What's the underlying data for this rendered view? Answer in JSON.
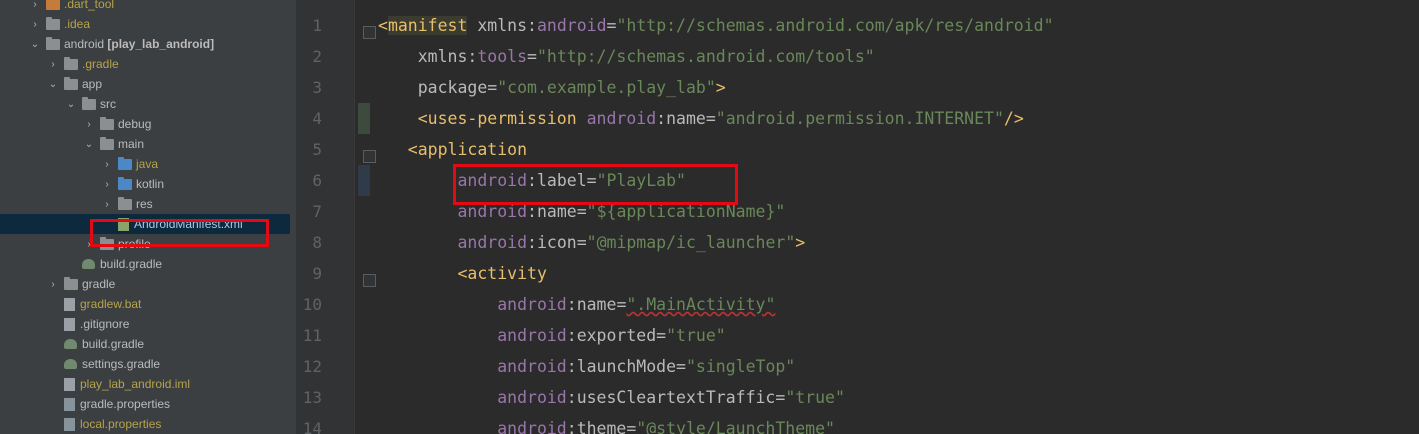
{
  "tree": {
    "items": [
      {
        "label": ".dart_tool",
        "indent": 1,
        "arrow": "right",
        "icon": "folder-orange",
        "style": "yellow"
      },
      {
        "label": ".idea",
        "indent": 1,
        "arrow": "right",
        "icon": "folder-gray",
        "style": "yellow"
      },
      {
        "label": "android [play_lab_android]",
        "indent": 1,
        "arrow": "down",
        "icon": "folder-gray",
        "style": "bold"
      },
      {
        "label": ".gradle",
        "indent": 2,
        "arrow": "right",
        "icon": "folder-gray",
        "style": "yellow"
      },
      {
        "label": "app",
        "indent": 2,
        "arrow": "down",
        "icon": "folder-gray",
        "style": "normal"
      },
      {
        "label": "src",
        "indent": 3,
        "arrow": "down",
        "icon": "folder-gray",
        "style": "normal"
      },
      {
        "label": "debug",
        "indent": 4,
        "arrow": "right",
        "icon": "folder-gray",
        "style": "normal"
      },
      {
        "label": "main",
        "indent": 4,
        "arrow": "down",
        "icon": "folder-gray",
        "style": "normal"
      },
      {
        "label": "java",
        "indent": 5,
        "arrow": "right",
        "icon": "folder-blue",
        "style": "yellow"
      },
      {
        "label": "kotlin",
        "indent": 5,
        "arrow": "right",
        "icon": "folder-blue",
        "style": "normal"
      },
      {
        "label": "res",
        "indent": 5,
        "arrow": "right",
        "icon": "folder-gray",
        "style": "normal"
      },
      {
        "label": "AndroidManifest.xml",
        "indent": 5,
        "arrow": "none",
        "icon": "file-xml",
        "style": "selected"
      },
      {
        "label": "profile",
        "indent": 4,
        "arrow": "right",
        "icon": "folder-gray",
        "style": "normal"
      },
      {
        "label": "build.gradle",
        "indent": 3,
        "arrow": "none",
        "icon": "file-gradle",
        "style": "normal"
      },
      {
        "label": "gradle",
        "indent": 2,
        "arrow": "right",
        "icon": "folder-gray",
        "style": "normal"
      },
      {
        "label": "gradlew.bat",
        "indent": 2,
        "arrow": "none",
        "icon": "file-doc",
        "style": "yellow"
      },
      {
        "label": ".gitignore",
        "indent": 2,
        "arrow": "none",
        "icon": "file-doc",
        "style": "normal"
      },
      {
        "label": "build.gradle",
        "indent": 2,
        "arrow": "none",
        "icon": "file-gradle",
        "style": "normal"
      },
      {
        "label": "settings.gradle",
        "indent": 2,
        "arrow": "none",
        "icon": "file-gradle",
        "style": "normal"
      },
      {
        "label": "play_lab_android.iml",
        "indent": 2,
        "arrow": "none",
        "icon": "file-iml",
        "style": "yellow"
      },
      {
        "label": "gradle.properties",
        "indent": 2,
        "arrow": "none",
        "icon": "file-props",
        "style": "normal"
      },
      {
        "label": "local.properties",
        "indent": 2,
        "arrow": "none",
        "icon": "file-props",
        "style": "yellow"
      }
    ]
  },
  "editor": {
    "lines": [
      {
        "num": "1",
        "tokens": [
          [
            "bracket",
            "<"
          ],
          [
            "tag",
            "manifest"
          ],
          [
            "attr",
            " xmlns"
          ],
          [
            "eq",
            ":"
          ],
          [
            "ns",
            "android"
          ],
          [
            "eq",
            "="
          ],
          [
            "val",
            "\"http://schemas.android.com/apk/res/android\""
          ]
        ]
      },
      {
        "num": "2",
        "tokens": [
          [
            "attr",
            "    xmlns"
          ],
          [
            "eq",
            ":"
          ],
          [
            "ns",
            "tools"
          ],
          [
            "eq",
            "="
          ],
          [
            "val",
            "\"http://schemas.android.com/tools\""
          ]
        ]
      },
      {
        "num": "3",
        "tokens": [
          [
            "attr",
            "    package"
          ],
          [
            "eq",
            "="
          ],
          [
            "val",
            "\"com.example.play_lab\""
          ],
          [
            "bracket",
            ">"
          ]
        ]
      },
      {
        "num": "4",
        "tokens": [
          [
            "bracket",
            "    <"
          ],
          [
            "tag",
            "uses-permission"
          ],
          [
            "ns",
            " android"
          ],
          [
            "eq",
            ":"
          ],
          [
            "attr",
            "name"
          ],
          [
            "eq",
            "="
          ],
          [
            "val",
            "\"android.permission.INTERNET\""
          ],
          [
            "bracket",
            "/>"
          ]
        ]
      },
      {
        "num": "5",
        "tokens": [
          [
            "bracket",
            "   <"
          ],
          [
            "tag",
            "application"
          ]
        ]
      },
      {
        "num": "6",
        "tokens": [
          [
            "ns",
            "        android"
          ],
          [
            "eq",
            ":"
          ],
          [
            "attr",
            "label"
          ],
          [
            "eq",
            "="
          ],
          [
            "val",
            "\"PlayLab\""
          ]
        ]
      },
      {
        "num": "7",
        "tokens": [
          [
            "ns",
            "        android"
          ],
          [
            "eq",
            ":"
          ],
          [
            "attr",
            "name"
          ],
          [
            "eq",
            "="
          ],
          [
            "val",
            "\"${applicationName}\""
          ]
        ]
      },
      {
        "num": "8",
        "tokens": [
          [
            "ns",
            "        android"
          ],
          [
            "eq",
            ":"
          ],
          [
            "attr",
            "icon"
          ],
          [
            "eq",
            "="
          ],
          [
            "val",
            "\"@mipmap/ic_launcher\""
          ],
          [
            "bracket",
            ">"
          ]
        ]
      },
      {
        "num": "9",
        "tokens": [
          [
            "bracket",
            "        <"
          ],
          [
            "tag",
            "activity"
          ]
        ]
      },
      {
        "num": "10",
        "tokens": [
          [
            "ns",
            "            android"
          ],
          [
            "eq",
            ":"
          ],
          [
            "attr",
            "name"
          ],
          [
            "eq",
            "="
          ],
          [
            "val",
            "\".MainActivity\""
          ]
        ]
      },
      {
        "num": "11",
        "tokens": [
          [
            "ns",
            "            android"
          ],
          [
            "eq",
            ":"
          ],
          [
            "attr",
            "exported"
          ],
          [
            "eq",
            "="
          ],
          [
            "val",
            "\"true\""
          ]
        ]
      },
      {
        "num": "12",
        "tokens": [
          [
            "ns",
            "            android"
          ],
          [
            "eq",
            ":"
          ],
          [
            "attr",
            "launchMode"
          ],
          [
            "eq",
            "="
          ],
          [
            "val",
            "\"singleTop\""
          ]
        ]
      },
      {
        "num": "13",
        "tokens": [
          [
            "ns",
            "            android"
          ],
          [
            "eq",
            ":"
          ],
          [
            "attr",
            "usesCleartextTraffic"
          ],
          [
            "eq",
            "="
          ],
          [
            "val",
            "\"true\""
          ]
        ]
      },
      {
        "num": "14",
        "tokens": [
          [
            "ns",
            "            android"
          ],
          [
            "eq",
            ":"
          ],
          [
            "attr",
            "theme"
          ],
          [
            "eq",
            "="
          ],
          [
            "val",
            "\"@style/LaunchTheme\""
          ]
        ]
      }
    ]
  },
  "colors": {
    "highlight_box": "#e50914",
    "tag": "#e8bf6a",
    "namespace": "#9876aa",
    "value": "#6a8759"
  }
}
